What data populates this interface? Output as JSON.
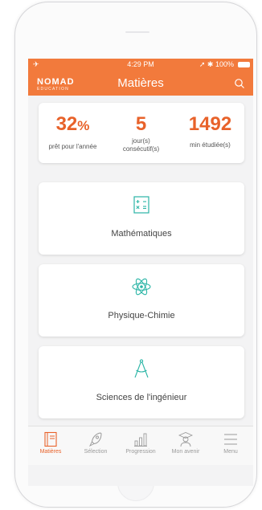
{
  "status_bar": {
    "time": "4:29 PM",
    "battery": "100%"
  },
  "header": {
    "logo_top": "NOMAD",
    "logo_bottom": "EDUCATION",
    "title": "Matières"
  },
  "stats": [
    {
      "value": "32",
      "unit": "%",
      "label": "prêt pour l'année"
    },
    {
      "value": "5",
      "unit": "",
      "label_line1": "jour(s)",
      "label_line2": "consécutif(s)"
    },
    {
      "value": "1492",
      "unit": "",
      "label": "min étudiée(s)"
    }
  ],
  "subjects": [
    {
      "name": "Mathématiques",
      "icon": "calculator-icon"
    },
    {
      "name": "Physique-Chimie",
      "icon": "atom-icon"
    },
    {
      "name": "Sciences de l'ingénieur",
      "icon": "compass-icon"
    }
  ],
  "tabbar": {
    "items": [
      {
        "label": "Matières",
        "icon": "book-icon"
      },
      {
        "label": "Sélection",
        "icon": "rocket-icon"
      },
      {
        "label": "Progression",
        "icon": "bar-chart-icon"
      },
      {
        "label": "Mon avenir",
        "icon": "graduate-icon"
      },
      {
        "label": "Menu",
        "icon": "hamburger-icon"
      }
    ],
    "active": "Matières"
  },
  "colors": {
    "accent": "#f27a3c",
    "accent_text": "#e8622a",
    "icon_teal": "#2bb5a6"
  }
}
